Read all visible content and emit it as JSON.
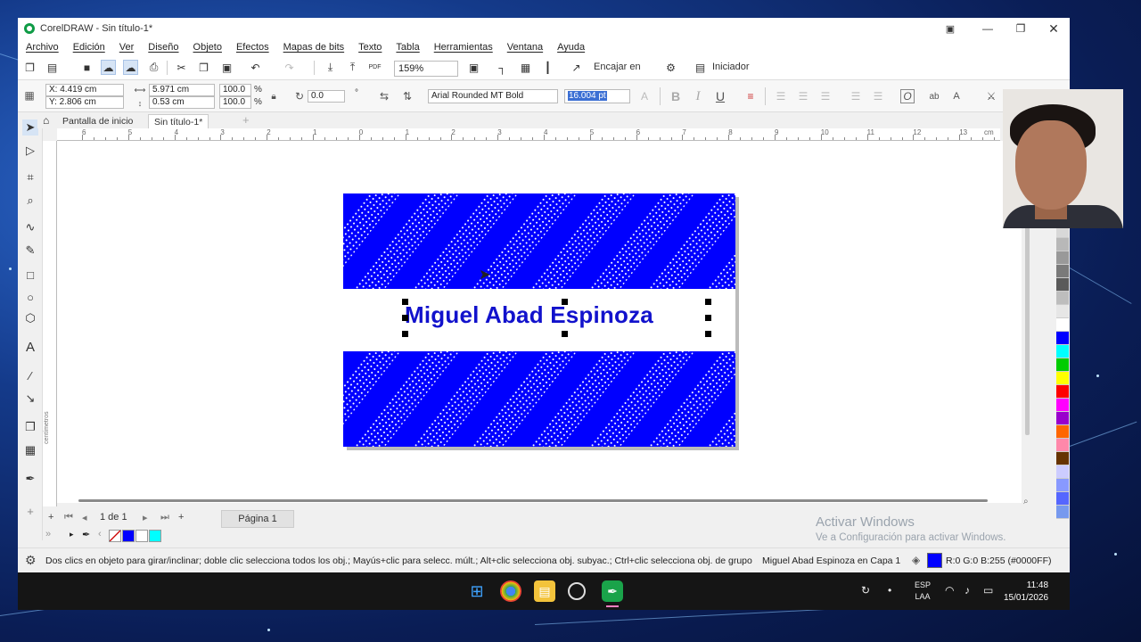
{
  "window": {
    "title": "CorelDRAW - Sin título-1*"
  },
  "menu": [
    "Archivo",
    "Edición",
    "Ver",
    "Diseño",
    "Objeto",
    "Efectos",
    "Mapas de bits",
    "Texto",
    "Tabla",
    "Herramientas",
    "Ventana",
    "Ayuda"
  ],
  "toolbar": {
    "zoom": "159%",
    "snap_label": "Encajar en",
    "launcher_label": "Iniciador"
  },
  "properties": {
    "x": "X: 4.419 cm",
    "y": "Y: 2.806 cm",
    "width": "5.971 cm",
    "height": "0.53 cm",
    "scale_w": "100.0",
    "scale_h": "100.0",
    "percent": "%",
    "rotation": "0.0",
    "font": "Arial Rounded MT Bold",
    "font_size": "16.004 pt"
  },
  "tabs": {
    "home": "Pantalla de inicio",
    "document": "Sin título-1*"
  },
  "ruler": {
    "h_labels": [
      "6",
      "5",
      "4",
      "3",
      "2",
      "1",
      "0",
      "1",
      "2",
      "3",
      "4",
      "5",
      "6",
      "7",
      "8",
      "9",
      "10",
      "11",
      "12",
      "13"
    ],
    "unit": "cm",
    "v_unit": "centímetros"
  },
  "card": {
    "name": "Miguel Abad Espinoza",
    "bg_color": "#0000ff",
    "text_color": "#1212cc"
  },
  "pages": {
    "counter": "1 de 1",
    "page_tab": "Página 1"
  },
  "doc_palette": [
    "#0000ff",
    "#ffffff",
    "#00ffff"
  ],
  "palette": [
    "#d8d8d8",
    "#b8b8b8",
    "#999999",
    "#7a7a7a",
    "#5a5a5a",
    "#bdbdbd",
    "#e6e6e6",
    "#ffffff",
    "#0000ff",
    "#00ffff",
    "#00cc00",
    "#ffff00",
    "#ff0000",
    "#ff00ff",
    "#9900cc",
    "#ff6600",
    "#ff88aa",
    "#663300",
    "#ccccff",
    "#8899ff",
    "#5566ff",
    "#7799ee"
  ],
  "watermark": {
    "line1": "Activar Windows",
    "line2": "Ve a Configuración para activar Windows."
  },
  "status": {
    "hint": "Dos clics en objeto para girar/inclinar; doble clic selecciona todos los obj.; Mayús+clic para selecc. múlt.; Alt+clic selecciona obj. subyac.; Ctrl+clic selecciona obj. de grupo",
    "object": "Miguel Abad Espinoza en Capa 1",
    "fill": "R:0 G:0 B:255 (#0000FF)",
    "fill_color": "#0000ff"
  },
  "taskbar": {
    "lang": "ESP",
    "layout": "LAA",
    "time": "11:48",
    "date": "15/01/2026"
  }
}
